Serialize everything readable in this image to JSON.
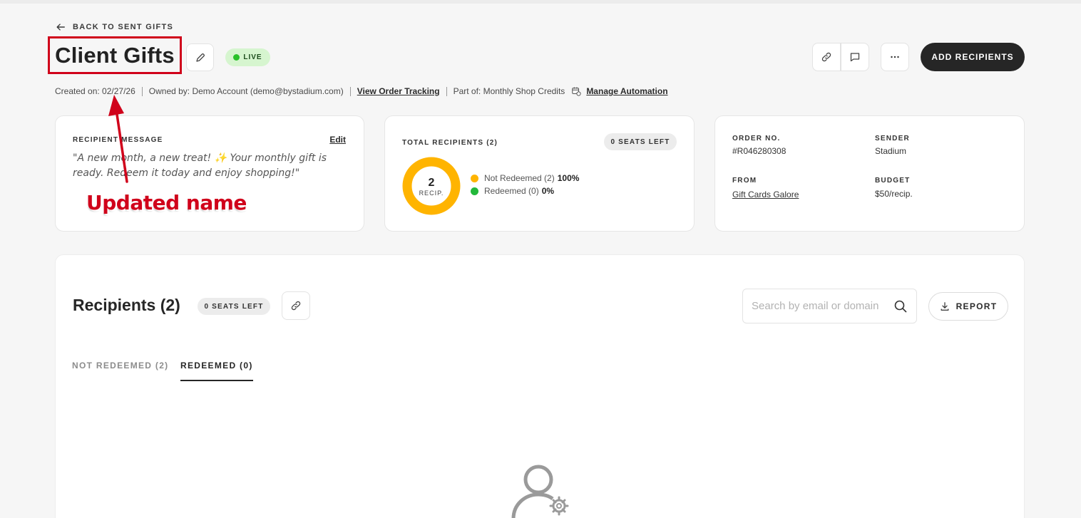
{
  "header": {
    "back_label": "BACK TO SENT GIFTS",
    "title": "Client Gifts",
    "status": "LIVE",
    "add_recipients_label": "ADD RECIPIENTS"
  },
  "meta": {
    "created": "Created on: 02/27/26",
    "owned": "Owned by: Demo Account (demo@bystadium.com)",
    "tracking_link": "View Order Tracking",
    "part_of": "Part of: Monthly Shop Credits",
    "automation_link": "Manage Automation"
  },
  "message_card": {
    "label": "RECIPIENT MESSAGE",
    "edit_label": "Edit",
    "message": "\"A new month, a new treat! ✨ Your monthly gift is ready. Redeem it today and enjoy shopping!\""
  },
  "recipients_card": {
    "label": "TOTAL RECIPIENTS (2)",
    "seats_left": "0 SEATS LEFT",
    "donut_number": "2",
    "donut_label": "RECIP.",
    "not_redeemed_label": "Not Redeemed (2)",
    "not_redeemed_pct": "100%",
    "redeemed_label": "Redeemed (0)",
    "redeemed_pct": "0%",
    "not_redeemed_fraction": 1.0,
    "colors": {
      "not_redeemed": "#ffb400",
      "redeemed": "#22b83a"
    }
  },
  "order_card": {
    "order_no_label": "ORDER NO.",
    "order_no": "#R046280308",
    "sender_label": "SENDER",
    "sender": "Stadium",
    "from_label": "FROM",
    "from": "Gift Cards Galore",
    "budget_label": "BUDGET",
    "budget": "$50/recip."
  },
  "recipients_section": {
    "title": "Recipients (2)",
    "seats_left": "0 SEATS LEFT",
    "search_placeholder": "Search by email or domain",
    "report_label": "REPORT",
    "tabs": [
      {
        "label": "NOT REDEEMED (2)",
        "active": false
      },
      {
        "label": "REDEEMED (0)",
        "active": true
      }
    ]
  },
  "annotation": {
    "text": "Updated name",
    "color": "#d0021b"
  }
}
